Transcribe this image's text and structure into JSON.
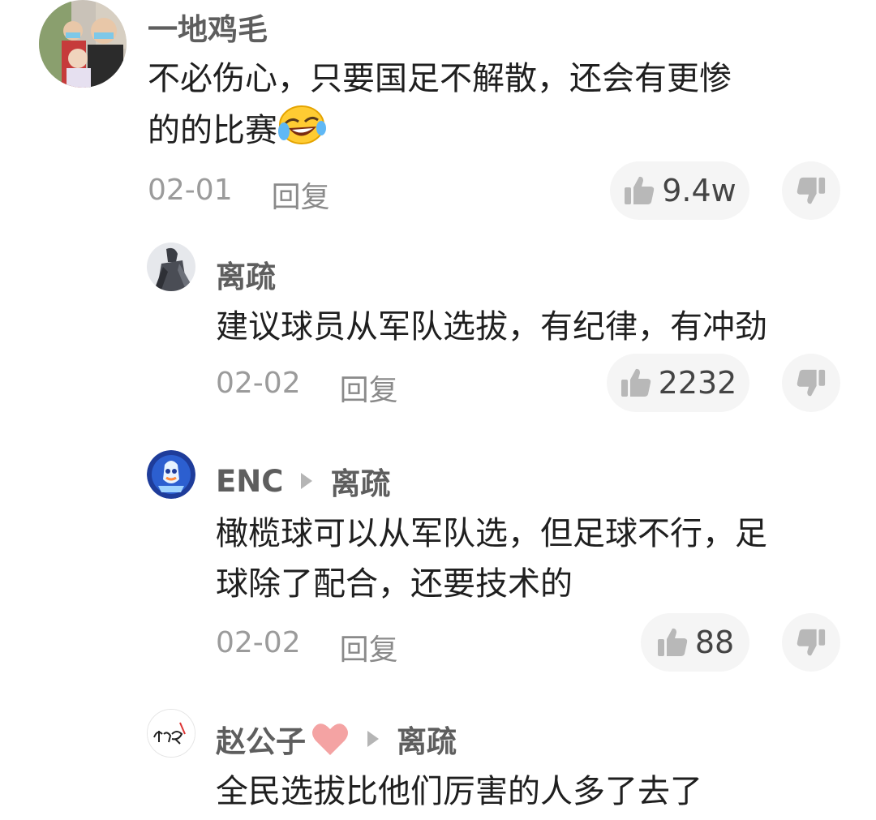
{
  "comments": [
    {
      "author": "一地鸡毛",
      "text_line1": "不必伤心，只要国足不解散，还会有更惨",
      "text_line2": "的的比赛",
      "emoji_icon": "rofl-icon",
      "date": "02-01",
      "reply_label": "回复",
      "likes": "9.4w"
    },
    {
      "author": "离疏",
      "text_line1": "建议球员从军队选拔，有纪律，有冲劲",
      "date": "02-02",
      "reply_label": "回复",
      "likes": "2232"
    },
    {
      "author": "ENC",
      "reply_to": "离疏",
      "text_line1": "橄榄球可以从军队选，但足球不行，足",
      "text_line2": "球除了配合，还要技术的",
      "date": "02-02",
      "reply_label": "回复",
      "likes": "88"
    },
    {
      "author": "赵公子",
      "author_badge_icon": "heart-icon",
      "reply_to": "离疏",
      "text_line1": "全民选拔比他们厉害的人多了去了"
    }
  ],
  "colors": {
    "name": "#5e5e5e",
    "meta": "#9b9b9b",
    "pill_bg": "#f5f5f5",
    "heart": "#f0a0a0"
  }
}
